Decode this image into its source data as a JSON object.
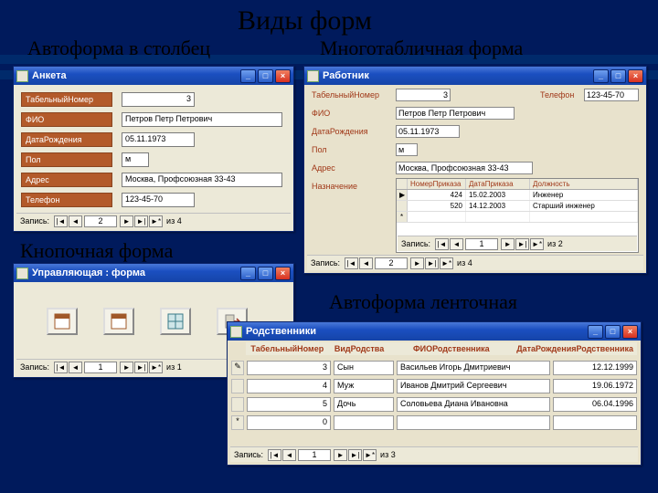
{
  "title": "Виды форм",
  "sections": {
    "columnar": "Автоформа в столбец",
    "multitable": "Многотабличная форма",
    "button": "Кнопочная форма",
    "ribbon": "Автоформа ленточная"
  },
  "columnarWin": {
    "title": "Анкета",
    "fields": {
      "tabnum_label": "ТабельныйНомер",
      "tabnum_value": "3",
      "fio_label": "ФИО",
      "fio_value": "Петров Петр Петрович",
      "dob_label": "ДатаРождения",
      "dob_value": "05.11.1973",
      "sex_label": "Пол",
      "sex_value": "м",
      "addr_label": "Адрес",
      "addr_value": "Москва, Профсоюзная 33-43",
      "tel_label": "Телефон",
      "tel_value": "123-45-70"
    },
    "nav": {
      "label": "Запись:",
      "pos": "2",
      "of": "из 4"
    }
  },
  "multiWin": {
    "title": "Работник",
    "fields": {
      "tabnum_label": "ТабельныйНомер",
      "tabnum_value": "3",
      "tel_label": "Телефон",
      "tel_value": "123-45-70",
      "fio_label": "ФИО",
      "fio_value": "Петров Петр Петрович",
      "dob_label": "ДатаРождения",
      "dob_value": "05.11.1973",
      "sex_label": "Пол",
      "sex_value": "м",
      "addr_label": "Адрес",
      "addr_value": "Москва, Профсоюзная 33-43",
      "assign_label": "Назначение"
    },
    "sub": {
      "headers": {
        "num": "НомерПриказа",
        "date": "ДатаПриказа",
        "pos": "Должность"
      },
      "rows": [
        {
          "sel": "▶",
          "num": "424",
          "date": "15.02.2003",
          "pos": "Инженер"
        },
        {
          "sel": "",
          "num": "520",
          "date": "14.12.2003",
          "pos": "Старший инженер"
        },
        {
          "sel": "*",
          "num": "",
          "date": "",
          "pos": ""
        }
      ],
      "nav": {
        "label": "Запись:",
        "pos": "1",
        "of": "из 2"
      }
    },
    "nav": {
      "label": "Запись:",
      "pos": "2",
      "of": "из 4"
    }
  },
  "buttonWin": {
    "title": "Управляющая : форма",
    "buttons": [
      "form-icon-1",
      "form-icon-2",
      "form-icon-3",
      "exit-icon"
    ],
    "nav": {
      "label": "Запись:",
      "pos": "1",
      "of": "из 1"
    }
  },
  "ribbonWin": {
    "title": "Родственники",
    "headers": {
      "tabnum": "ТабельныйНомер",
      "rel": "ВидРодства",
      "fio": "ФИОРодственника",
      "dob": "ДатаРожденияРодственника"
    },
    "rows": [
      {
        "sel": "✎",
        "tabnum": "3",
        "rel": "Сын",
        "fio": "Васильев Игорь Дмитриевич",
        "dob": "12.12.1999"
      },
      {
        "sel": "",
        "tabnum": "4",
        "rel": "Муж",
        "fio": "Иванов Дмитрий Сергеевич",
        "dob": "19.06.1972"
      },
      {
        "sel": "",
        "tabnum": "5",
        "rel": "Дочь",
        "fio": "Соловьева Диана Ивановна",
        "dob": "06.04.1996"
      },
      {
        "sel": "*",
        "tabnum": "0",
        "rel": "",
        "fio": "",
        "dob": ""
      }
    ],
    "nav": {
      "label": "Запись:",
      "pos": "1",
      "of": "из 3"
    }
  },
  "winbtn": {
    "min": "_",
    "max": "□",
    "close": "×"
  },
  "navglyph": {
    "first": "|◄",
    "prev": "◄",
    "next": "►",
    "last": "►|",
    "new": "►*"
  }
}
